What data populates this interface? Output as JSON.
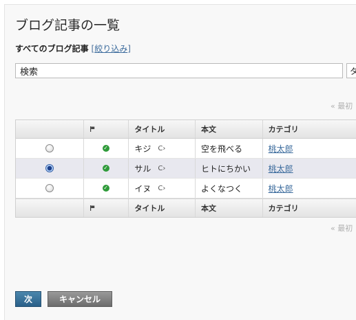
{
  "page": {
    "title": "ブログ記事の一覧",
    "subhead_label": "すべてのブログ記事",
    "filter_link": "絞り込み",
    "search_value": "検索",
    "search_button": "タ",
    "pager_top": "« 最初",
    "pager_bottom": "« 最初"
  },
  "table": {
    "headers": {
      "title": "タイトル",
      "body": "本文",
      "category": "カテゴリ"
    },
    "rows": [
      {
        "title": "キジ",
        "body": "空を飛べる",
        "category": "桃太郎",
        "selected": false
      },
      {
        "title": "サル",
        "body": "ヒトにちかい",
        "category": "桃太郎",
        "selected": true
      },
      {
        "title": "イヌ",
        "body": "よくなつく",
        "category": "桃太郎",
        "selected": false
      }
    ]
  },
  "buttons": {
    "next": "次",
    "cancel": "キャンセル"
  },
  "icons": {
    "flag": "flag-icon",
    "status": "check-circle-icon",
    "link": "cycle-arrow-icon"
  },
  "colors": {
    "accent": "#2a6089",
    "link": "#3a6a9c",
    "status_ok": "#2f9b3a"
  }
}
